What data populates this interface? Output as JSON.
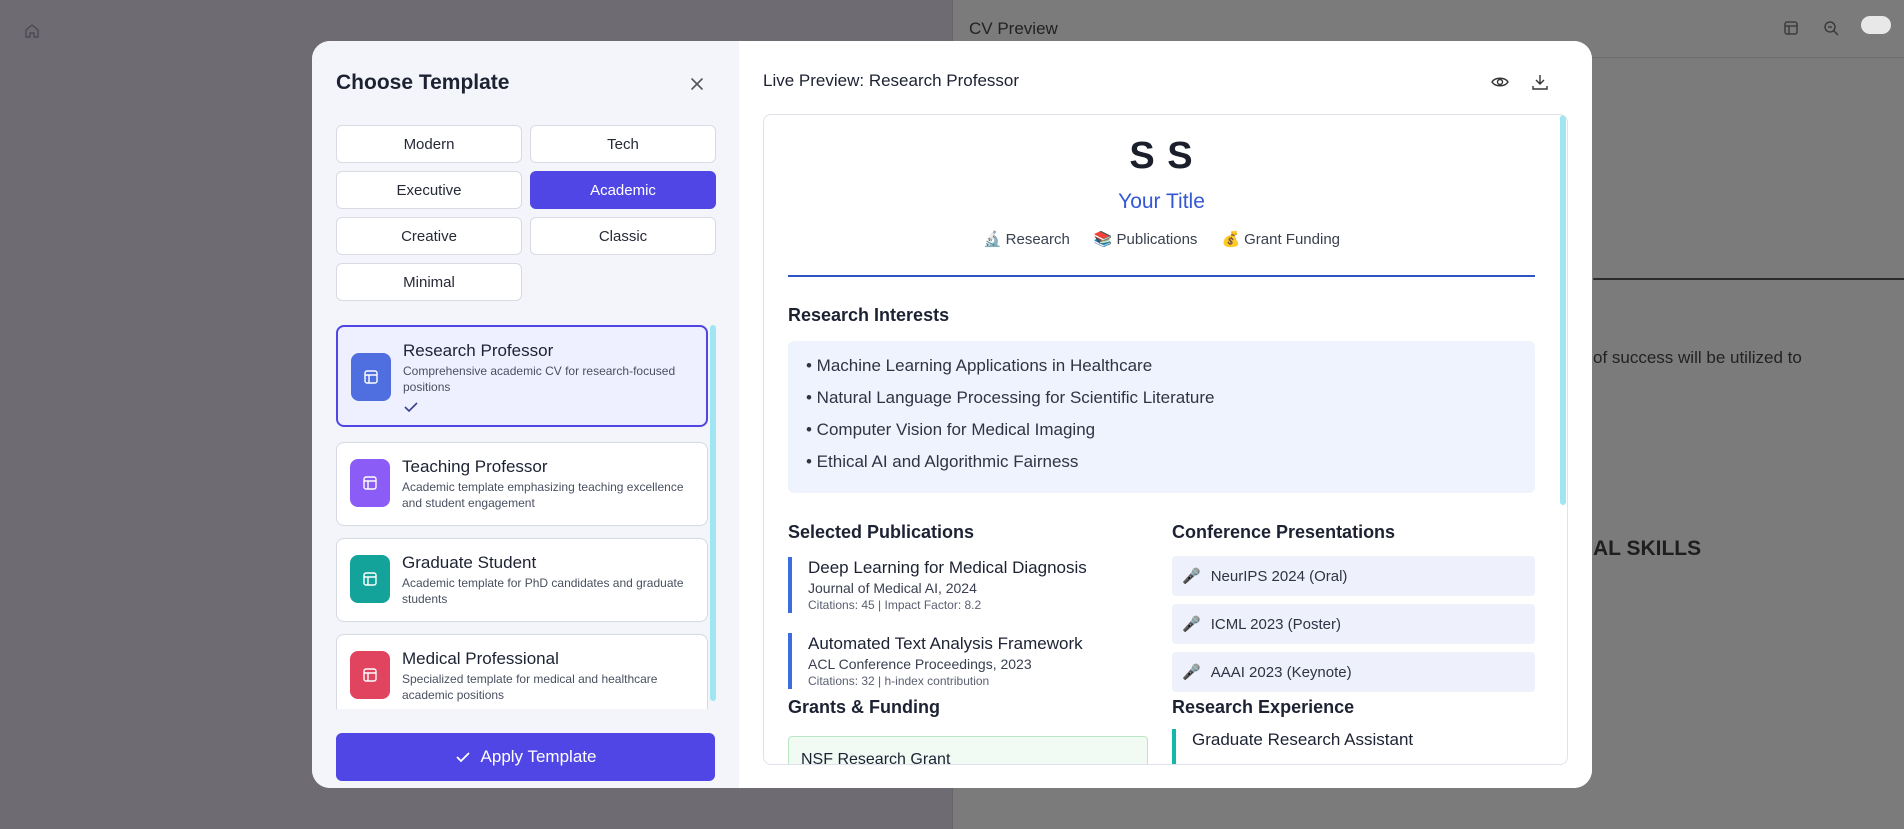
{
  "background": {
    "preview_title": "CV Preview",
    "body_text": "of success will be utilized to",
    "section_text": "AL SKILLS",
    "icons": [
      "home-icon",
      "layout-icon",
      "zoom-out-icon",
      "toggle-switch"
    ]
  },
  "modal": {
    "title": "Choose Template",
    "close_icon": "close-icon",
    "categories": [
      {
        "label": "Modern",
        "active": false
      },
      {
        "label": "Tech",
        "active": false
      },
      {
        "label": "Executive",
        "active": false
      },
      {
        "label": "Academic",
        "active": true
      },
      {
        "label": "Creative",
        "active": false
      },
      {
        "label": "Classic",
        "active": false
      },
      {
        "label": "Minimal",
        "active": false
      }
    ],
    "templates": [
      {
        "name": "Research Professor",
        "description": "Comprehensive academic CV for research-focused positions",
        "color": "#4f6ee0",
        "selected": true
      },
      {
        "name": "Teaching Professor",
        "description": "Academic template emphasizing teaching excellence and student engagement",
        "color": "#8b5cf6",
        "selected": false
      },
      {
        "name": "Graduate Student",
        "description": "Academic template for PhD candidates and graduate students",
        "color": "#14a39a",
        "selected": false
      },
      {
        "name": "Medical Professional",
        "description": "Specialized template for medical and healthcare academic positions",
        "color": "#e0445e",
        "selected": false
      }
    ],
    "apply_label": "Apply Template",
    "preview": {
      "title": "Live Preview: Research Professor",
      "icons": [
        "eye-icon",
        "download-icon"
      ],
      "cv": {
        "name": "S S",
        "job_title": "Your Title",
        "tags": [
          {
            "icon": "🔬",
            "label": "Research"
          },
          {
            "icon": "📚",
            "label": "Publications"
          },
          {
            "icon": "💰",
            "label": "Grant Funding"
          }
        ],
        "research_interests_heading": "Research Interests",
        "research_interests": [
          "• Machine Learning Applications in Healthcare",
          "• Natural Language Processing for Scientific Literature",
          "• Computer Vision for Medical Imaging",
          "• Ethical AI and Algorithmic Fairness"
        ],
        "publications_heading": "Selected Publications",
        "publications": [
          {
            "title": "Deep Learning for Medical Diagnosis",
            "journal": "Journal of Medical AI, 2024",
            "citations": "Citations: 45 | Impact Factor: 8.2"
          },
          {
            "title": "Automated Text Analysis Framework",
            "journal": "ACL Conference Proceedings, 2023",
            "citations": "Citations: 32 | h-index contribution"
          }
        ],
        "conferences_heading": "Conference Presentations",
        "conferences": [
          {
            "icon": "🎤",
            "label": "NeurIPS 2024 (Oral)"
          },
          {
            "icon": "🎤",
            "label": "ICML 2023 (Poster)"
          },
          {
            "icon": "🎤",
            "label": "AAAI 2023 (Keynote)"
          }
        ],
        "grants_heading": "Grants & Funding",
        "grant_first": "NSF Research Grant",
        "experience_heading": "Research Experience",
        "experience_first": "Graduate Research Assistant"
      }
    }
  }
}
